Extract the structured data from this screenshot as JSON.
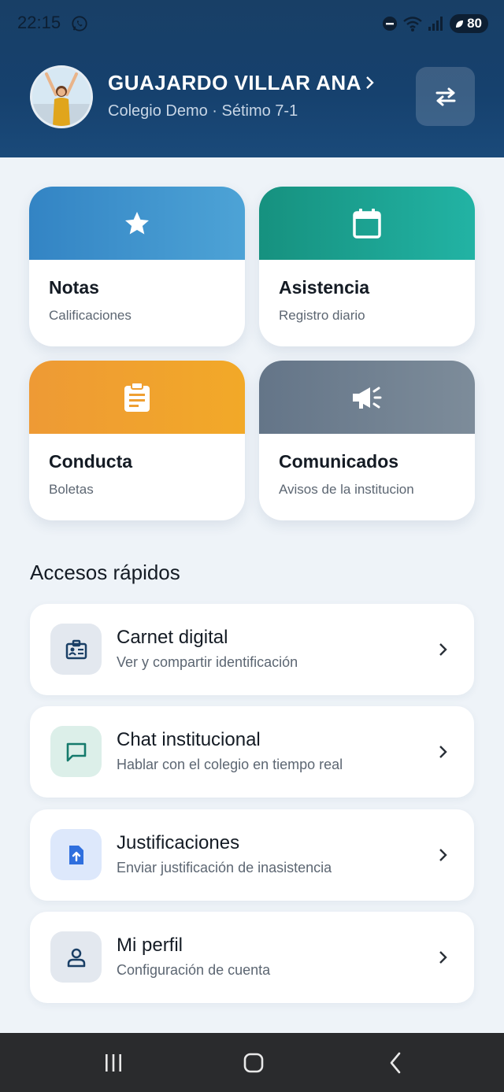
{
  "status_bar": {
    "time": "22:15",
    "battery": "80",
    "icons": [
      "whatsapp-icon",
      "do-not-disturb-icon",
      "wifi-icon",
      "signal-icon",
      "battery-icon"
    ]
  },
  "header": {
    "student_name": "GUAJARDO VILLAR ANA",
    "school_line": "Colegio Demo · Sétimo 7-1",
    "colors": {
      "background": "#183f66"
    }
  },
  "cards": [
    {
      "title": "Notas",
      "subtitle": "Calificaciones",
      "icon": "star-icon",
      "color": "#3a8fc9"
    },
    {
      "title": "Asistencia",
      "subtitle": "Registro diario",
      "icon": "calendar-icon",
      "color": "#1ea193"
    },
    {
      "title": "Conducta",
      "subtitle": "Boletas",
      "icon": "clipboard-icon",
      "color": "#f0a030"
    },
    {
      "title": "Comunicados",
      "subtitle": "Avisos de la institucion",
      "icon": "megaphone-icon",
      "color": "#6f7f90"
    }
  ],
  "quick_access": {
    "title": "Accesos rápidos",
    "items": [
      {
        "title": "Carnet digital",
        "subtitle": "Ver y compartir identificación",
        "icon": "id-badge-icon"
      },
      {
        "title": "Chat institucional",
        "subtitle": "Hablar con el colegio en tiempo real",
        "icon": "chat-icon"
      },
      {
        "title": "Justificaciones",
        "subtitle": "Enviar justificación de inasistencia",
        "icon": "file-upload-icon"
      },
      {
        "title": "Mi perfil",
        "subtitle": "Configuración de cuenta",
        "icon": "person-icon"
      }
    ]
  },
  "nav": {
    "icons": [
      "recent-apps-icon",
      "home-icon",
      "back-icon"
    ]
  }
}
